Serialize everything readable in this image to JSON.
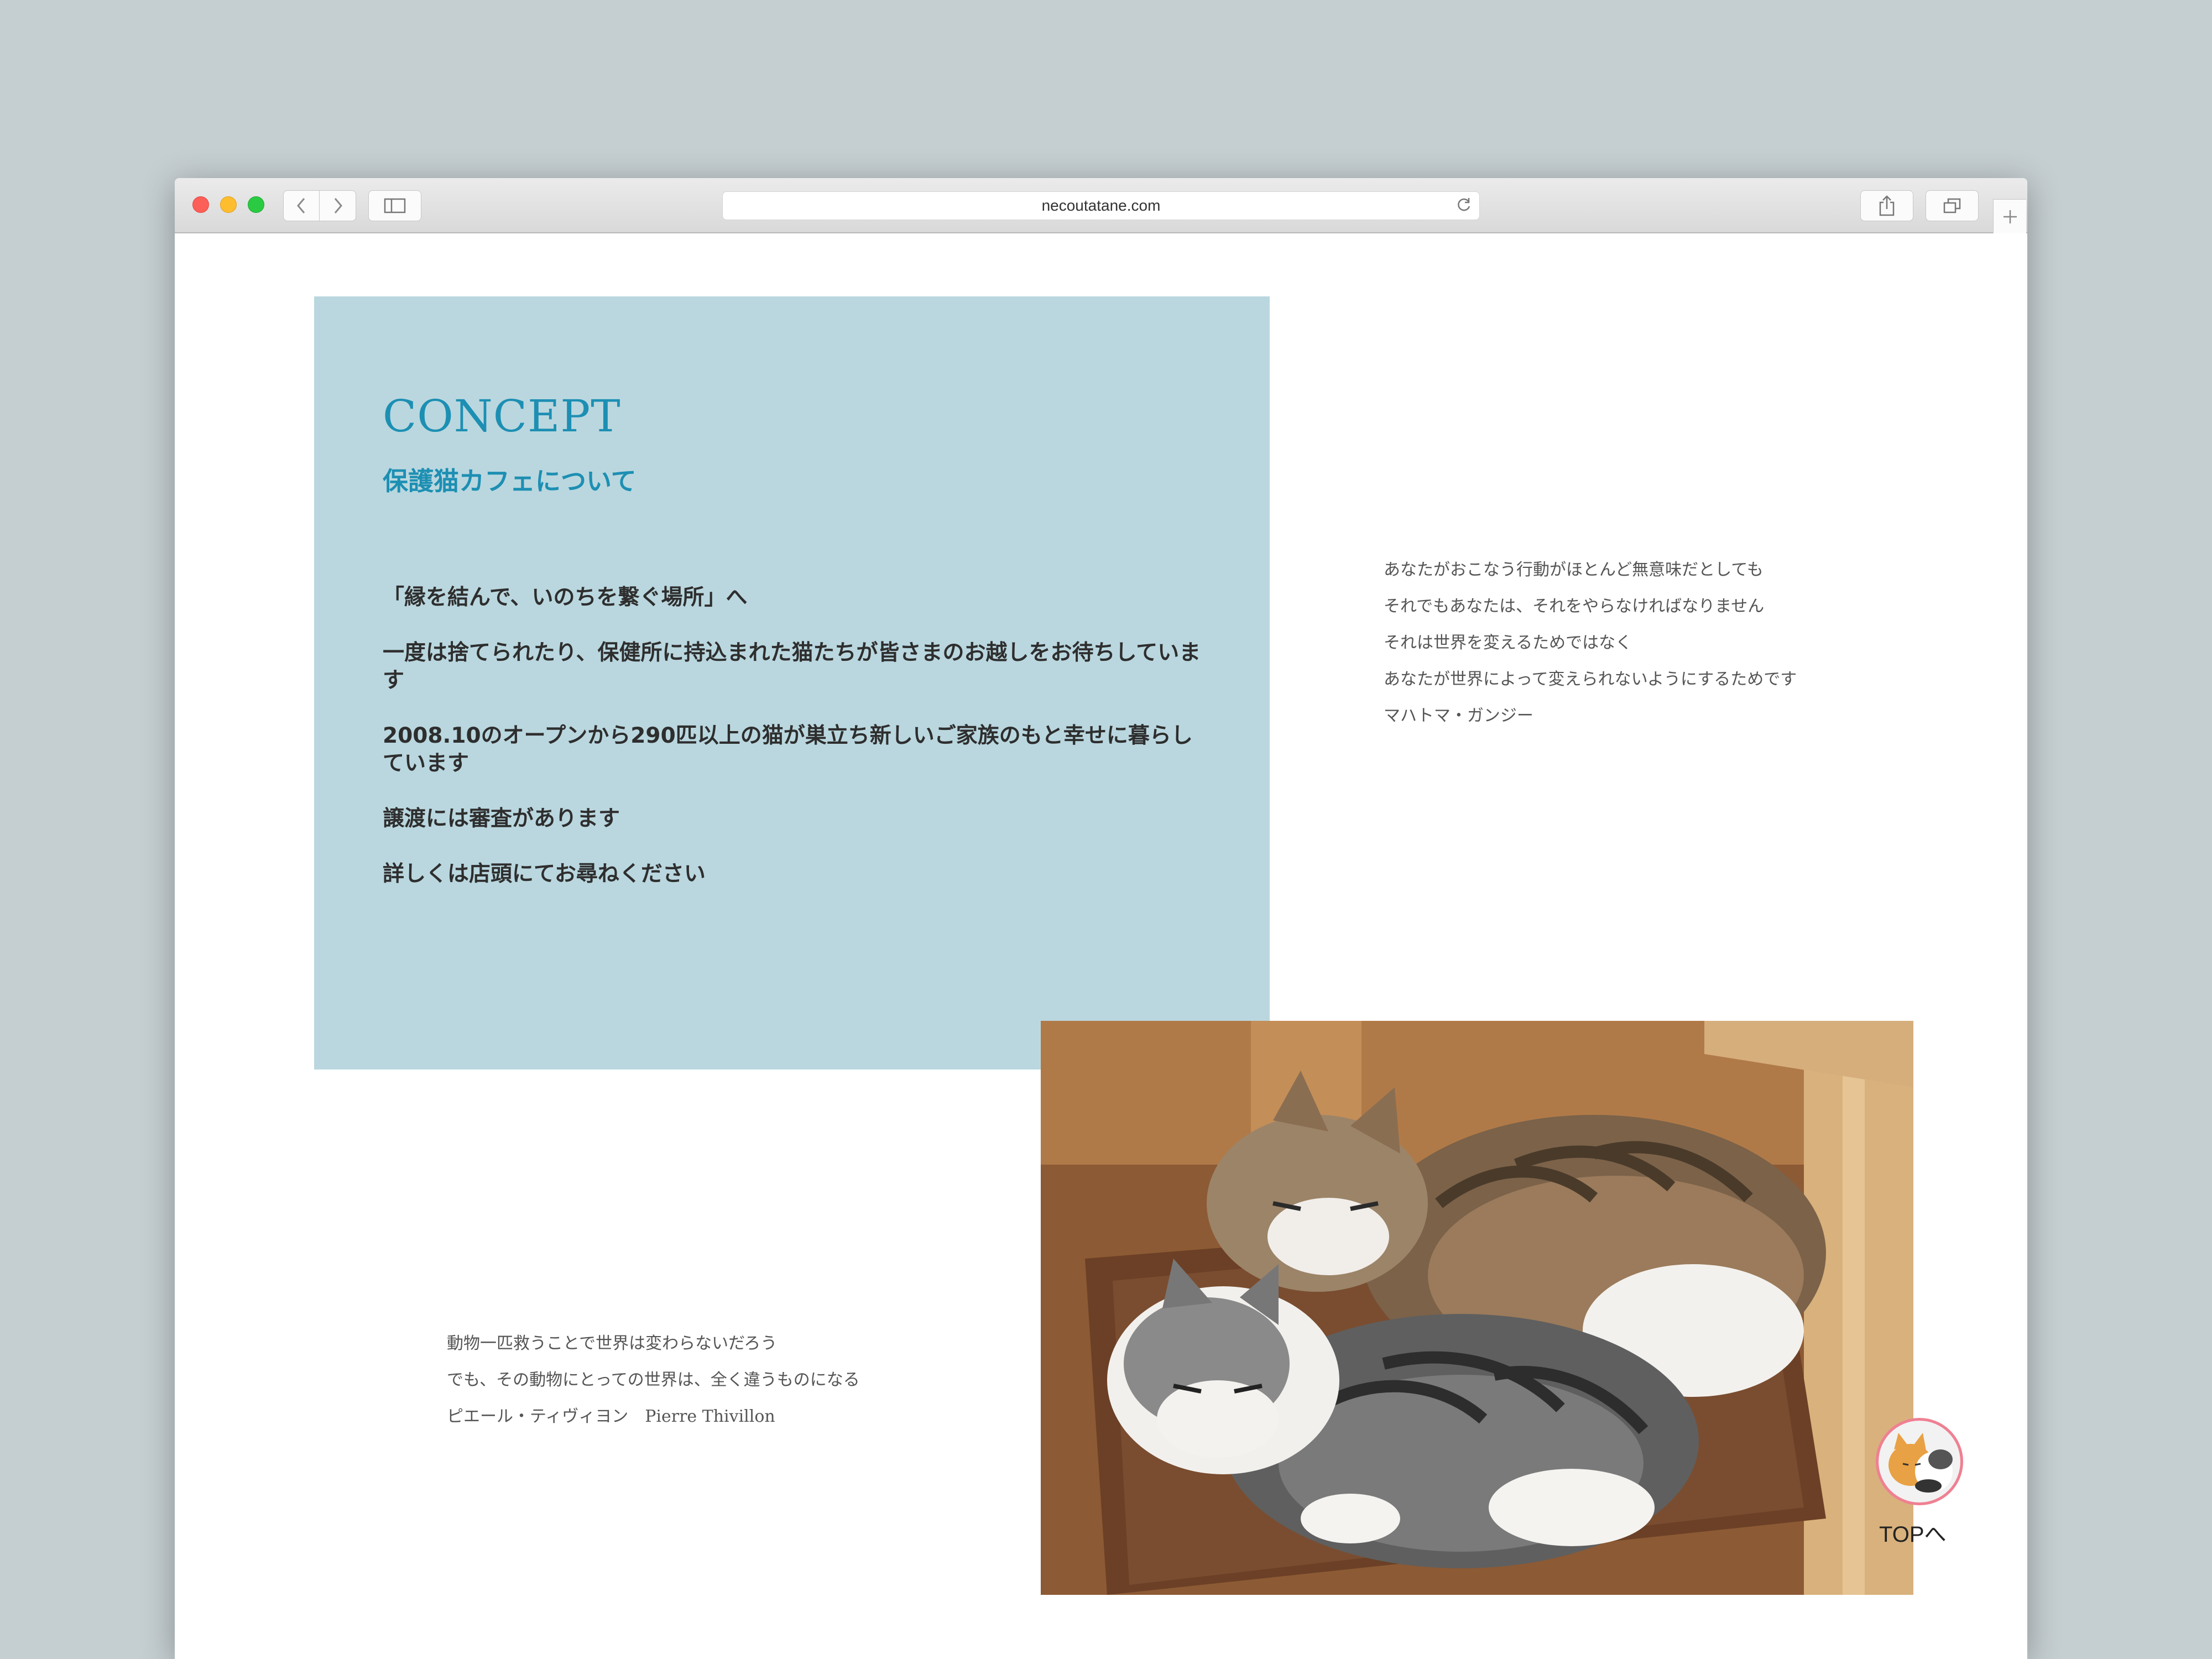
{
  "browser": {
    "url": "necoutatane.com"
  },
  "concept": {
    "title": "CONCEPT",
    "subtitle": "保護猫カフェについて",
    "paragraphs": [
      "「縁を結んで、いのちを繋ぐ場所」へ",
      "一度は捨てられたり、保健所に持込まれた猫たちが皆さまのお越しをお待ちしています",
      "2008.10のオープンから290匹以上の猫が巣立ち新しいご家族のもと幸せに暮らしています",
      "譲渡には審査があります",
      "詳しくは店頭にてお尋ねください"
    ]
  },
  "quote_right": {
    "lines": [
      "あなたがおこなう行動がほとんど無意味だとしても",
      "それでもあなたは、それをやらなければなりません",
      "それは世界を変えるためではなく",
      "あなたが世界によって変えられないようにするためです",
      "マハトマ・ガンジー"
    ]
  },
  "quote_left": {
    "lines": [
      "動物一匹救うことで世界は変わらないだろう",
      "でも、その動物にとっての世界は、全く違うものになる",
      "ピエール・ティヴィヨン　Pierre Thivillon"
    ]
  },
  "top_link": {
    "label": "TOPへ"
  },
  "colors": {
    "background": "#c5ced1",
    "concept_box": "#bad7df",
    "accent": "#1d8fb3",
    "badge": "#f29aa6"
  },
  "icons": [
    "back-icon",
    "forward-icon",
    "sidebar-icon",
    "reload-icon",
    "share-icon",
    "tabs-icon",
    "plus-icon",
    "cat-icon"
  ]
}
